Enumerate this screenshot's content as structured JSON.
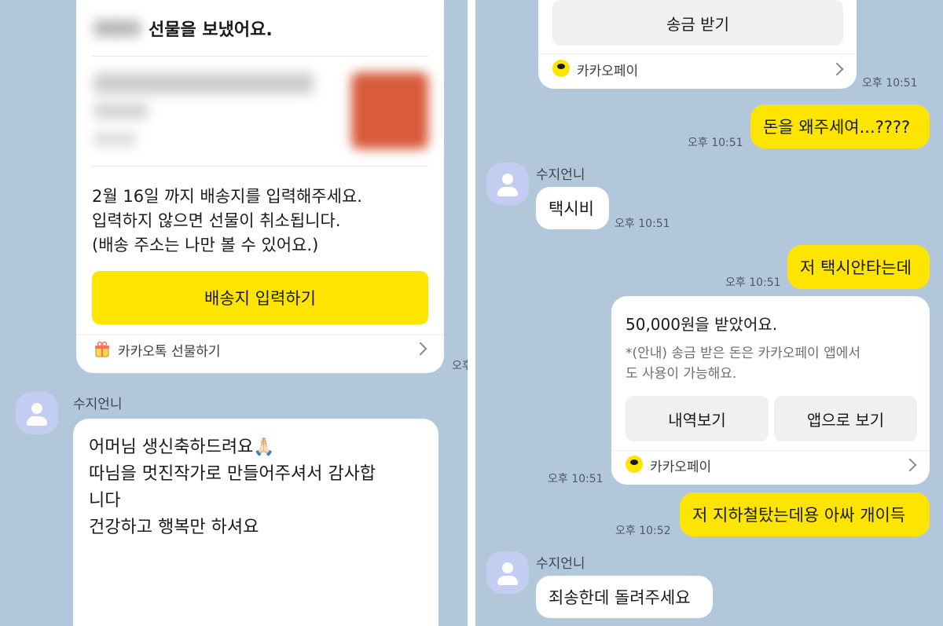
{
  "left_panel": {
    "gift_card": {
      "title": "선물을 보냈어요.",
      "notice_line1": "2월 16일 까지 배송지를 입력해주세요.",
      "notice_line2": "입력하지 않으면 선물이 취소됩니다.",
      "notice_line3": "(배송 주소는 나만 볼 수 있어요.)",
      "button_label": "배송지 입력하기",
      "footer_label": "카카오톡 선물하기"
    },
    "timestamp_cut": "오후",
    "message": {
      "sender": "수지언니",
      "line1": "어머님 생신축하드려요🙏🏻",
      "line2": "따님을 멋진작가로 만들어주셔서 감사합",
      "line3": "니다",
      "line4": "건강하고 행복만 하셔요"
    }
  },
  "right_panel": {
    "transfer_card_top": {
      "button_label": "송금 받기",
      "footer_label": "카카오페이",
      "time": "오후 10:51"
    },
    "messages": [
      {
        "id": "m1",
        "side": "me",
        "text": "돈을 왜주세여...????",
        "time": "오후 10:51"
      },
      {
        "id": "m2",
        "side": "other",
        "sender": "수지언니",
        "text": "택시비",
        "time": "오후 10:51"
      },
      {
        "id": "m3",
        "side": "me",
        "text": "저 택시안타는데",
        "time": "오후 10:51"
      },
      {
        "id": "m5",
        "side": "me",
        "text": "저 지하철탔는데용 아싸 개이득",
        "time": "오후 10:52"
      },
      {
        "id": "m6",
        "side": "other",
        "sender": "수지언니",
        "text": "죄송한데 돌려주세요"
      }
    ],
    "received_card": {
      "title": "50,000원을 받았어요.",
      "note_line1": "*(안내) 송금 받은 돈은 카카오페이 앱에서",
      "note_line2": "도 사용이 가능해요.",
      "button_history": "내역보기",
      "button_app": "앱으로 보기",
      "footer_label": "카카오페이",
      "time": "오후 10:51"
    }
  },
  "colors": {
    "chat_background": "#b2c7da",
    "my_bubble": "#fee500",
    "gift_button": "#fee500",
    "other_bubble": "#ffffff"
  },
  "icons": [
    "gift-box-icon",
    "kakaopay-icon",
    "chevron-right-icon",
    "profile-avatar-icon"
  ]
}
